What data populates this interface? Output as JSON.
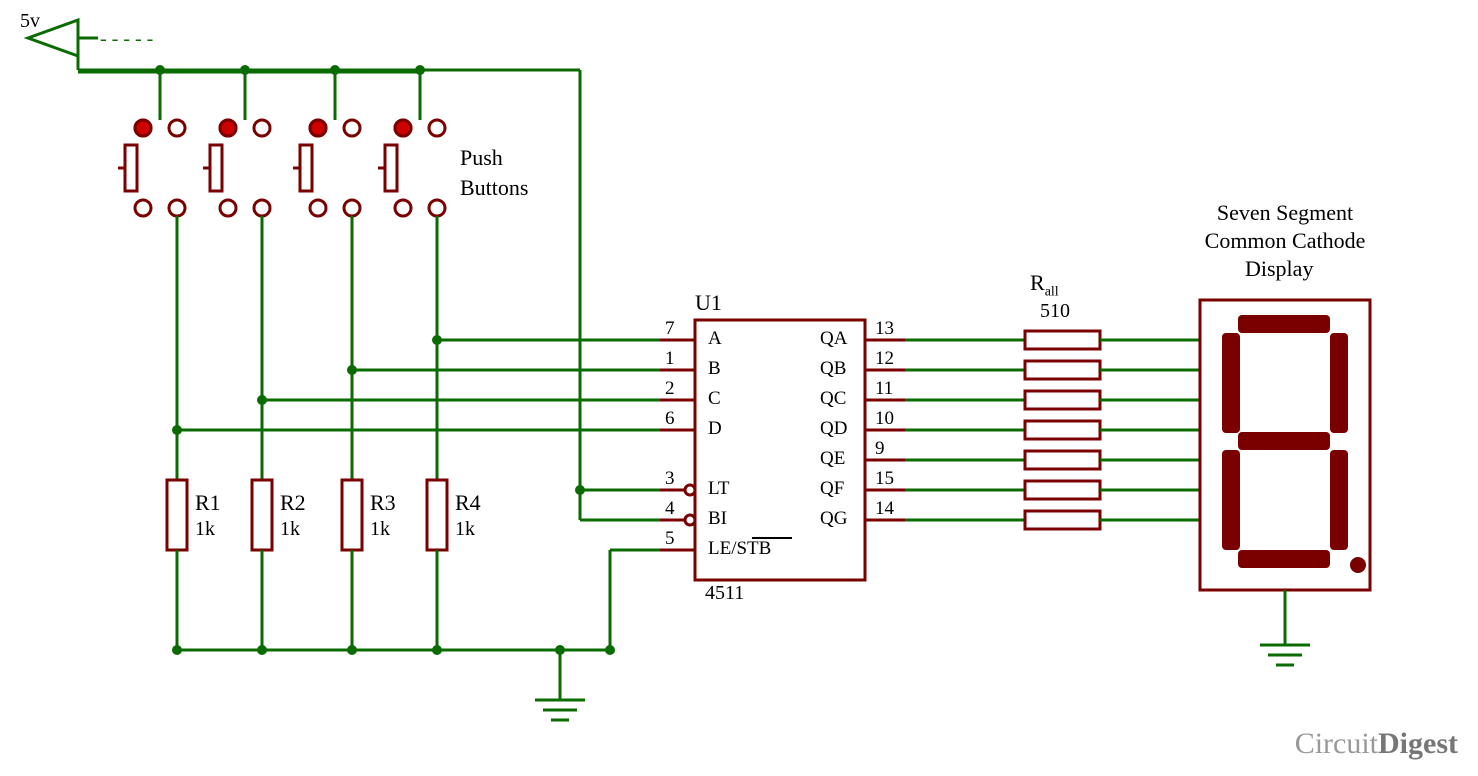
{
  "power": {
    "label": "5v",
    "dash": "- - - - -"
  },
  "buttons_label_line1": "Push",
  "buttons_label_line2": "Buttons",
  "resistors": {
    "r1": {
      "name": "R1",
      "value": "1k"
    },
    "r2": {
      "name": "R2",
      "value": "1k"
    },
    "r3": {
      "name": "R3",
      "value": "1k"
    },
    "r4": {
      "name": "R4",
      "value": "1k"
    }
  },
  "ic": {
    "ref": "U1",
    "part": "4511",
    "left_pins": [
      {
        "num": "7",
        "name": "A"
      },
      {
        "num": "1",
        "name": "B"
      },
      {
        "num": "2",
        "name": "C"
      },
      {
        "num": "6",
        "name": "D"
      },
      {
        "num": "3",
        "name": "LT"
      },
      {
        "num": "4",
        "name": "BI"
      },
      {
        "num": "5",
        "name": "LE/STB"
      }
    ],
    "right_pins": [
      {
        "num": "13",
        "name": "QA"
      },
      {
        "num": "12",
        "name": "QB"
      },
      {
        "num": "11",
        "name": "QC"
      },
      {
        "num": "10",
        "name": "QD"
      },
      {
        "num": "9",
        "name": "QE"
      },
      {
        "num": "15",
        "name": "QF"
      },
      {
        "num": "14",
        "name": "QG"
      }
    ]
  },
  "rall": {
    "name": "Rall",
    "value": "510"
  },
  "display": {
    "line1": "Seven Segment",
    "line2": "Common Cathode",
    "line3": "Display"
  },
  "watermark": {
    "a": "Circuit",
    "b": "Digest"
  }
}
